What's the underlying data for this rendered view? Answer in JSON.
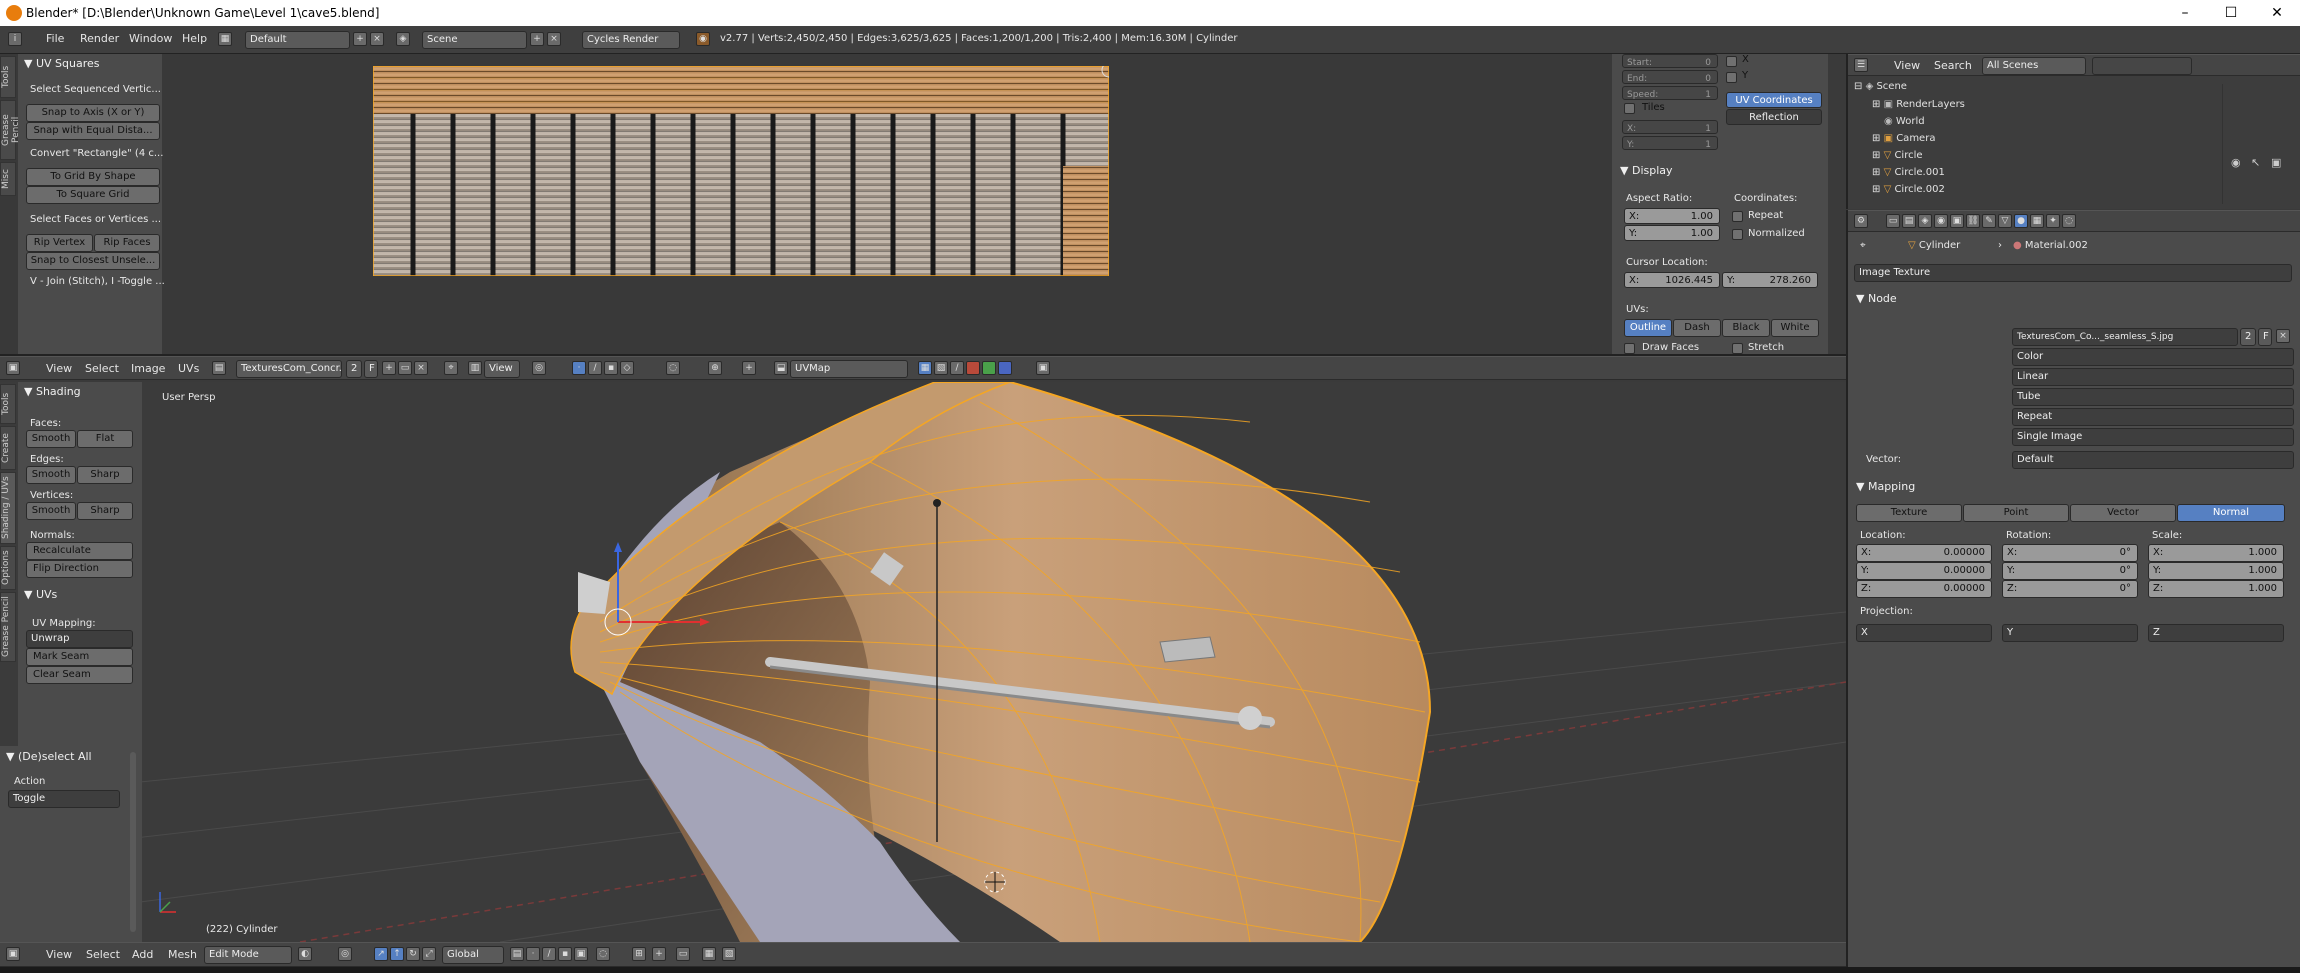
{
  "window": {
    "title": "Blender* [D:\\Blender\\Unknown Game\\Level 1\\cave5.blend]",
    "minimize": "–",
    "maximize": "☐",
    "close": "✕"
  },
  "infobar": {
    "menus": [
      "File",
      "Render",
      "Window",
      "Help"
    ],
    "layout": "Default",
    "scene": "Scene",
    "engine": "Cycles Render",
    "stats": "v2.77 | Verts:2,450/2,450 | Edges:3,625/3,625 | Faces:1,200/1,200 | Tris:2,400 | Mem:16.30M | Cylinder"
  },
  "uv_tools": {
    "title": "UV Squares",
    "select_hint": "Select Sequenced Vertic...",
    "snap_axis": "Snap to Axis (X or Y)",
    "snap_equal": "Snap with Equal Dista...",
    "convert_hint": "Convert \"Rectangle\" (4 c...",
    "grid_shape": "To Grid By Shape",
    "square_grid": "To Square Grid",
    "select_faces_hint": "Select Faces or Vertices ...",
    "rip_vertex": "Rip Vertex",
    "rip_faces": "Rip Faces",
    "snap_closest": "Snap to Closest Unsele...",
    "join_hint": "V - Join (Stitch), I -Toggle ...",
    "tabs": [
      "Tools",
      "Grease Pencil",
      "Misc"
    ]
  },
  "uv_props": {
    "start": "Start:",
    "end": "End:",
    "speed": "Speed:",
    "zero": "0",
    "one": "1",
    "x_chk": "X",
    "y_chk": "Y",
    "tiles": "Tiles",
    "tx": "X:",
    "ty": "Y:",
    "uv_coords": "UV Coordinates",
    "reflection": "Reflection",
    "display": "Display",
    "aspect": "Aspect Ratio:",
    "coordinates": "Coordinates:",
    "ax": "X:",
    "ay": "Y:",
    "ax_val": "1.00",
    "ay_val": "1.00",
    "repeat": "Repeat",
    "normalized": "Normalized",
    "cursor_loc": "Cursor Location:",
    "cx": "X:",
    "cx_val": "1026.445",
    "cy": "Y:",
    "cy_val": "278.260",
    "uvs": "UVs:",
    "outline": "Outline",
    "dash": "Dash",
    "black": "Black",
    "white": "White",
    "draw_faces": "Draw Faces",
    "stretch": "Stretch"
  },
  "uv_header": {
    "menus": [
      "View",
      "Select",
      "Image",
      "UVs"
    ],
    "image": "TexturesCom_Concr...",
    "users": "2",
    "fake": "F",
    "view": "View",
    "uvmap": "UVMap"
  },
  "tools_3d": {
    "tabs": [
      "Tools",
      "Create",
      "Shading / UVs",
      "Options",
      "Grease Pencil"
    ],
    "shading": "Shading",
    "faces": "Faces:",
    "edges": "Edges:",
    "vertices": "Vertices:",
    "smooth": "Smooth",
    "flat": "Flat",
    "sharp": "Sharp",
    "normals": "Normals:",
    "recalculate": "Recalculate",
    "flip": "Flip Direction",
    "uvs": "UVs",
    "uv_mapping": "UV Mapping:",
    "unwrap": "Unwrap",
    "mark_seam": "Mark Seam",
    "clear_seam": "Clear Seam",
    "deselect_all": "(De)select All",
    "action": "Action",
    "toggle": "Toggle"
  },
  "viewport": {
    "label": "User Persp",
    "object": "(222) Cylinder"
  },
  "footer_3d": {
    "menus": [
      "View",
      "Select",
      "Add",
      "Mesh"
    ],
    "mode": "Edit Mode",
    "orientation": "Global"
  },
  "outliner": {
    "view": "View",
    "search": "Search",
    "scenes": "All Scenes",
    "items": [
      "Scene",
      "RenderLayers",
      "World",
      "Camera",
      "Circle",
      "Circle.001",
      "Circle.002"
    ]
  },
  "properties": {
    "breadcrumb_obj": "Cylinder",
    "breadcrumb_mat": "Material.002",
    "node_type": "Image Texture",
    "node_title": "Node",
    "image_name": "TexturesCom_Co..._seamless_S.jpg",
    "image_users": "2",
    "image_fake": "F",
    "color": "Color",
    "interp": "Linear",
    "projection": "Tube",
    "extension": "Repeat",
    "source": "Single Image",
    "vector": "Vector:",
    "vector_val": "Default",
    "mapping": "Mapping",
    "map_types": [
      "Texture",
      "Point",
      "Vector",
      "Normal"
    ],
    "location": "Location:",
    "rotation": "Rotation:",
    "scale": "Scale:",
    "loc": [
      "0.00000",
      "0.00000",
      "0.00000"
    ],
    "rot": [
      "0°",
      "0°",
      "0°"
    ],
    "scl": [
      "1.000",
      "1.000",
      "1.000"
    ],
    "ax": [
      "X:",
      "Y:",
      "Z:"
    ],
    "proj_label": "Projection:",
    "proj": [
      "X",
      "Y",
      "Z"
    ]
  },
  "colors": {
    "accent": "#5680c2",
    "edit_orange": "#f5a623",
    "bg": "#3a3a3a"
  }
}
